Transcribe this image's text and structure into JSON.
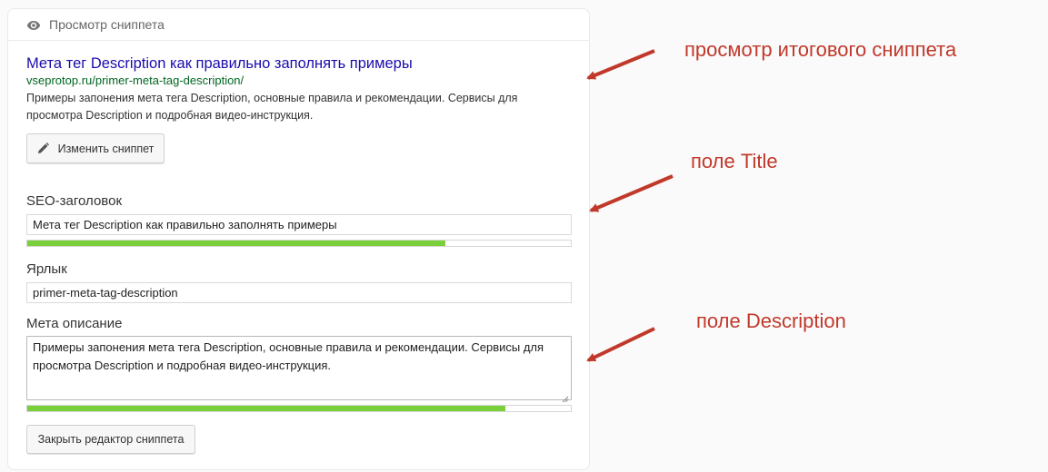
{
  "panel": {
    "header_title": "Просмотр сниппета"
  },
  "snippet": {
    "title": "Мета тег Description как правильно заполнять примеры",
    "url": "vseprotop.ru/primer-meta-tag-description/",
    "description": "Примеры запонения мета тега Description, основные правила и рекомендации. Сервисы для просмотра Description и подробная видео-инструкция."
  },
  "buttons": {
    "edit_snippet": "Изменить сниппет",
    "close_editor": "Закрыть редактор сниппета"
  },
  "form": {
    "seo_title_label": "SEO-заголовок",
    "seo_title_value": "Мета тег Description как правильно заполнять примеры",
    "seo_title_progress": 0.77,
    "slug_label": "Ярлык",
    "slug_value": "primer-meta-tag-description",
    "meta_label": "Мета описание",
    "meta_value": "Примеры запонения мета тега Description, основные правила и рекомендации. Сервисы для просмотра Description и подробная видео-инструкция.",
    "meta_progress": 0.88
  },
  "annotations": {
    "preview": "просмотр итогового сниппета",
    "title_field": "поле Title",
    "description_field": "поле Description"
  },
  "colors": {
    "link_title": "#1a0dab",
    "url_green": "#006621",
    "progress_green": "#7ad03a",
    "annotation_red": "#c0392b"
  },
  "icons": {
    "header": "eye-icon",
    "edit": "pencil-icon"
  }
}
